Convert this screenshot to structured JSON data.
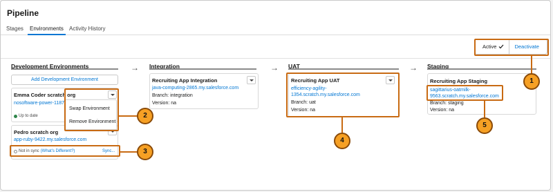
{
  "page": {
    "title": "Pipeline"
  },
  "tabs": [
    {
      "label": "Stages"
    },
    {
      "label": "Environments",
      "active": true
    },
    {
      "label": "Activity History"
    }
  ],
  "toolbar": {
    "active_label": "Active",
    "deactivate_label": "Deactivate"
  },
  "columns": {
    "development": {
      "title": "Development Environments",
      "add_button": "Add Development Environment",
      "cards": [
        {
          "name": "Emma Coder scratch org",
          "link": "nosoftware-power-1187",
          "status": "Up to date"
        },
        {
          "name": "Pedro scratch org",
          "link": "app-ruby-9422.my.salesforce.com",
          "status": "Not in sync",
          "status_link": "(What's Different?)",
          "sync_label": "Sync..."
        }
      ],
      "menu": [
        "Swap Environment",
        "Remove Environment"
      ]
    },
    "integration": {
      "title": "Integration",
      "card": {
        "name": "Recruiting App Integration",
        "link": "java-computing-2865.my.salesforce.com",
        "branch": "Branch: integration",
        "version": "Version: na"
      }
    },
    "uat": {
      "title": "UAT",
      "card": {
        "name": "Recruiting App UAT",
        "link1": "efficiency-agility-",
        "link2": "1354.scratch.my.salesforce.com",
        "branch": "Branch: uat",
        "version": "Version: na"
      }
    },
    "staging": {
      "title": "Staging",
      "card": {
        "name": "Recruiting App Staging",
        "link1": "sagittarius-oatmilk-",
        "link2": "9563.scratch.my.salesforce.com",
        "branch": "Branch: staging",
        "version": "Version: na"
      }
    }
  },
  "callouts": [
    "1",
    "2",
    "3",
    "4",
    "5"
  ],
  "colors": {
    "accent": "#0176d3",
    "highlight": "#c86a12",
    "callout_fill": "#f6a024"
  },
  "icons": {
    "check": "checkmark-icon",
    "arrow": "right-arrow-icon",
    "dropdown": "chevron-down-icon"
  }
}
